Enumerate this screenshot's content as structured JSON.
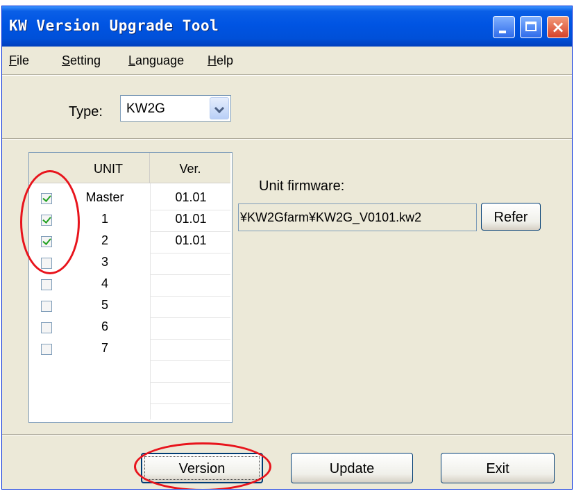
{
  "window": {
    "title": "KW Version Upgrade Tool"
  },
  "menu": {
    "file": "File",
    "setting": "Setting",
    "language": "Language",
    "help": "Help"
  },
  "type": {
    "label": "Type:",
    "value": "KW2G"
  },
  "table": {
    "headers": {
      "unit": "UNIT",
      "ver": "Ver."
    },
    "rows": [
      {
        "unit": "Master",
        "ver": "01.01",
        "checked": true
      },
      {
        "unit": "1",
        "ver": "01.01",
        "checked": true
      },
      {
        "unit": "2",
        "ver": "01.01",
        "checked": true
      },
      {
        "unit": "3",
        "ver": "",
        "checked": false
      },
      {
        "unit": "4",
        "ver": "",
        "checked": false
      },
      {
        "unit": "5",
        "ver": "",
        "checked": false
      },
      {
        "unit": "6",
        "ver": "",
        "checked": false
      },
      {
        "unit": "7",
        "ver": "",
        "checked": false
      }
    ]
  },
  "firmware": {
    "label": "Unit firmware:",
    "path": "¥KW2Gfarm¥KW2G_V0101.kw2",
    "refer_label": "Refer"
  },
  "buttons": {
    "version": "Version",
    "update": "Update",
    "exit": "Exit"
  },
  "icons": {
    "minimize": "minimize-icon",
    "maximize": "maximize-icon",
    "close": "close-icon",
    "dropdown": "chevron-down-icon"
  },
  "annotation_color": "#e8141c"
}
